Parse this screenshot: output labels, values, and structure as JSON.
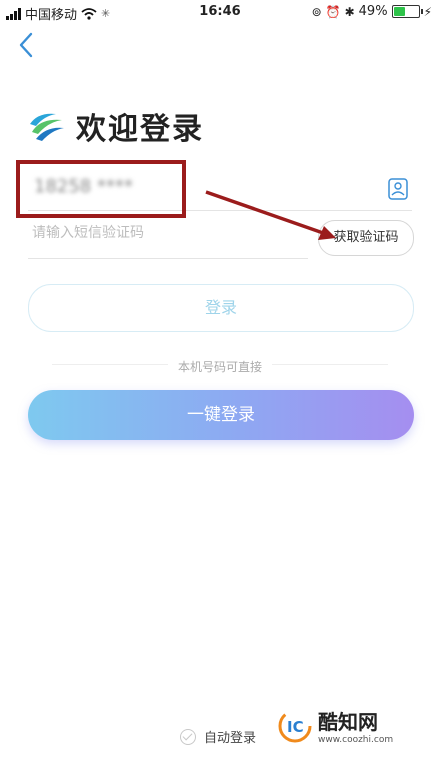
{
  "status_bar": {
    "carrier": "中国移动",
    "time": "16:46",
    "battery_percent": "49%",
    "battery_level": 0.49,
    "battery_color": "#2ec34a"
  },
  "nav": {
    "back_icon": "chevron-left-icon"
  },
  "header": {
    "title": "欢迎登录",
    "logo_icon": "china-mobile-logo"
  },
  "phone_field": {
    "value": "18258 ****",
    "icon": "person-card-icon"
  },
  "code_field": {
    "placeholder": "请输入短信验证码",
    "button_label": "获取验证码"
  },
  "login_button": {
    "label": "登录"
  },
  "divider": {
    "text": "本机号码可直接"
  },
  "onekey_button": {
    "label": "一键登录"
  },
  "auto_login": {
    "label": "自动登录"
  },
  "watermark": {
    "name": "酷知网",
    "url": "www.coozhi.com"
  },
  "colors": {
    "accent": "#9fd4ea",
    "gradient_start": "#7ec9ef",
    "gradient_end": "#a58ef0",
    "annotation": "#9b1c1c"
  }
}
